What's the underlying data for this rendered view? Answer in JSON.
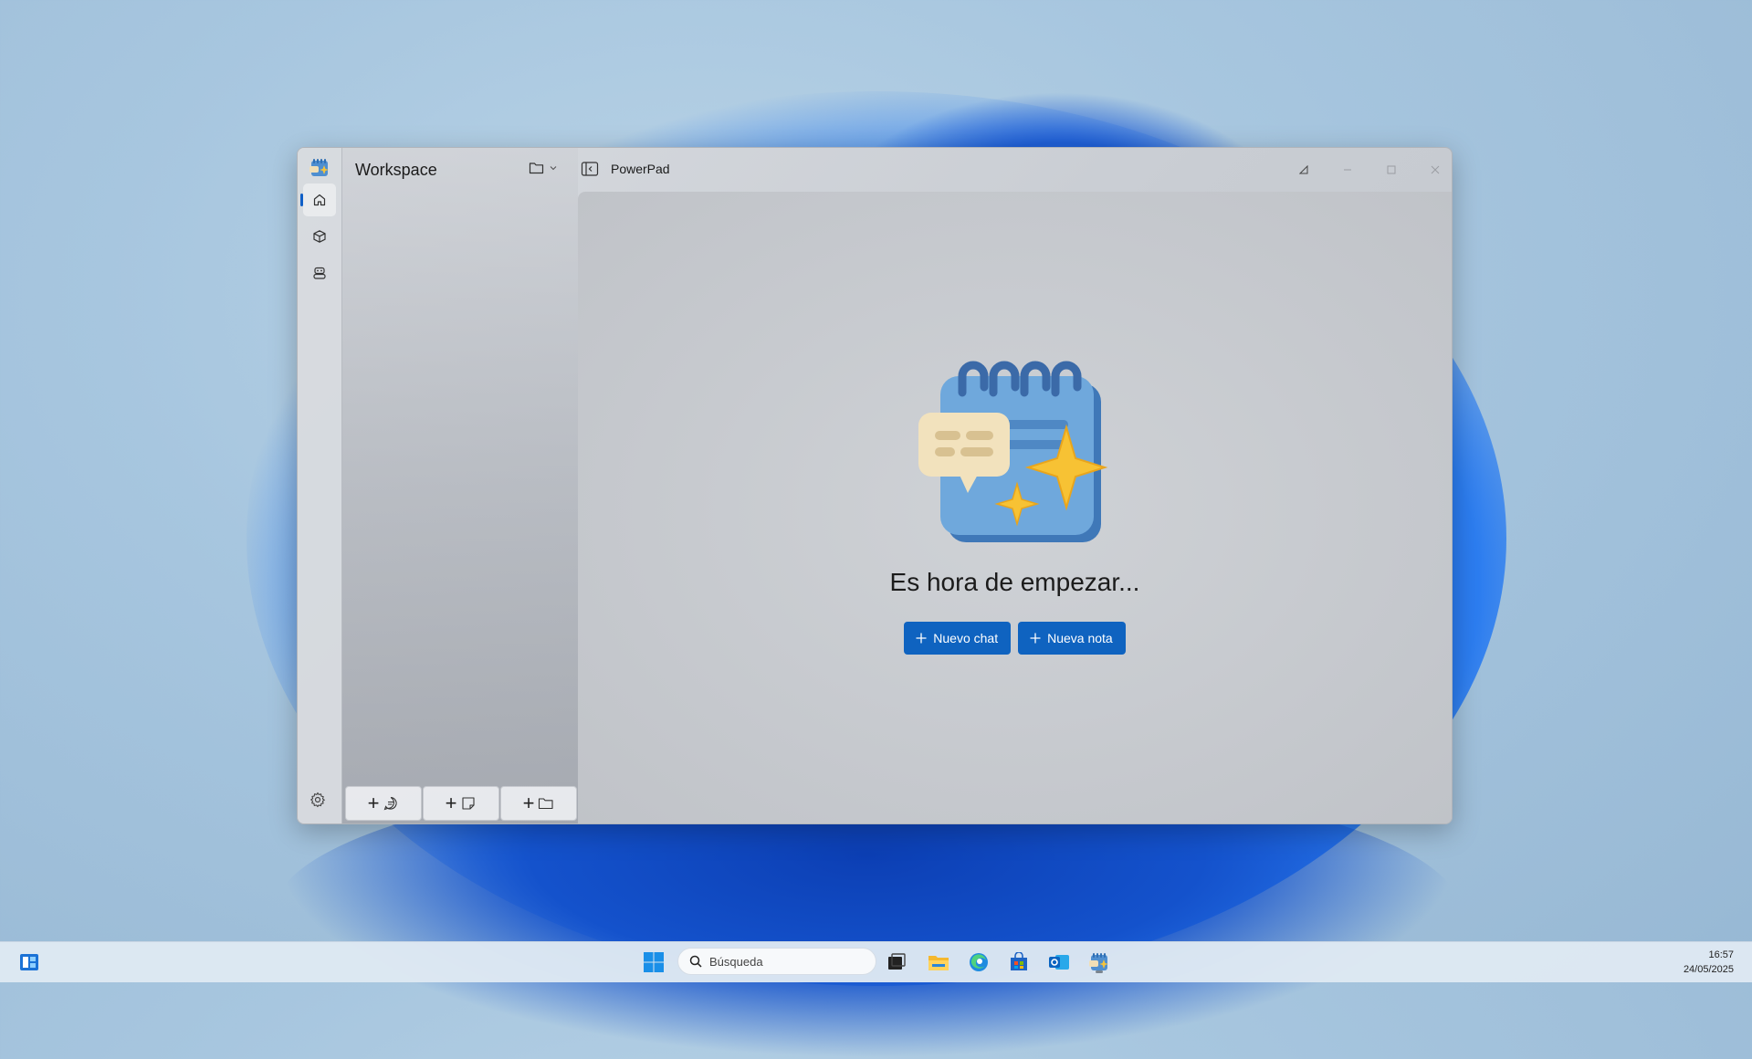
{
  "window": {
    "side_title": "Workspace",
    "app_title": "PowerPad"
  },
  "nav": {
    "items": [
      "home",
      "models",
      "agents"
    ]
  },
  "content": {
    "heading": "Es hora de empezar...",
    "new_chat_label": "Nuevo chat",
    "new_note_label": "Nueva nota"
  },
  "taskbar": {
    "search_placeholder": "Búsqueda",
    "time": "16:57",
    "date": "24/05/2025"
  },
  "colors": {
    "accent": "#0f63c0"
  }
}
